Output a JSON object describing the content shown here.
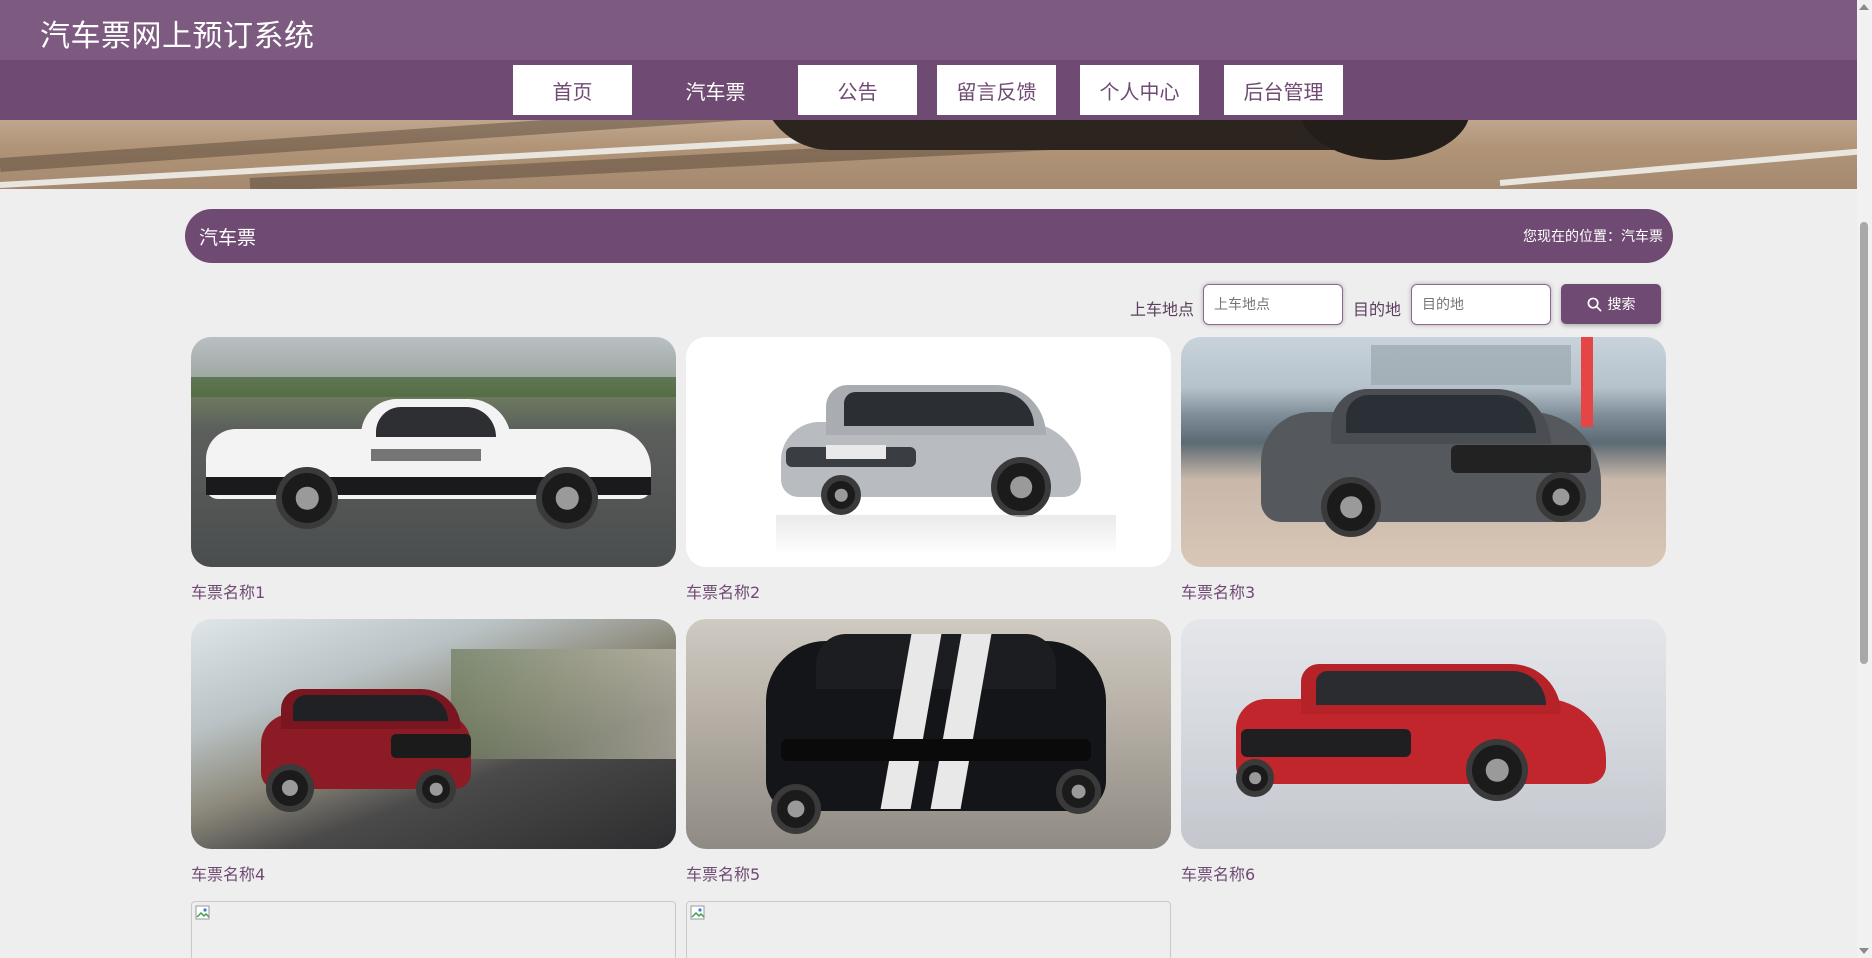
{
  "header": {
    "title": "汽车票网上预订系统"
  },
  "nav": {
    "items": [
      {
        "label": "首页"
      },
      {
        "label": "汽车票"
      },
      {
        "label": "公告"
      },
      {
        "label": "留言反馈"
      },
      {
        "label": "个人中心"
      },
      {
        "label": "后台管理"
      }
    ],
    "active_index": 1
  },
  "section": {
    "title": "汽车票",
    "location": "您现在的位置：汽车票"
  },
  "search": {
    "pickup_label": "上车地点",
    "pickup_placeholder": "上车地点",
    "destination_label": "目的地",
    "destination_placeholder": "目的地",
    "button_label": "搜索"
  },
  "tickets": [
    {
      "name": "车票名称1"
    },
    {
      "name": "车票名称2"
    },
    {
      "name": "车票名称3"
    },
    {
      "name": "车票名称4"
    },
    {
      "name": "车票名称5"
    },
    {
      "name": "车票名称6"
    }
  ],
  "colors": {
    "primary": "#6f4a72",
    "title_bar": "#7d5a80",
    "page_bg": "#eeeeee"
  }
}
